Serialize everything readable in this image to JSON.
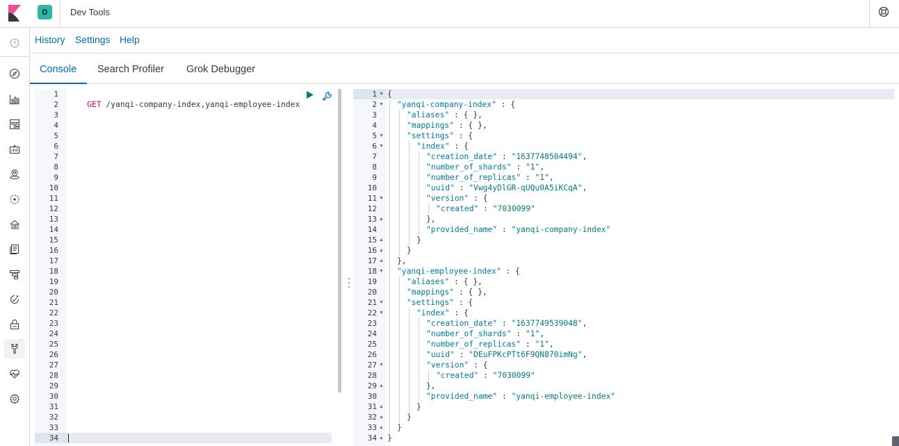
{
  "header": {
    "space_initial": "D",
    "title": "Dev Tools"
  },
  "menu": {
    "history": "History",
    "settings": "Settings",
    "help": "Help"
  },
  "tabs": [
    {
      "label": "Console",
      "active": true
    },
    {
      "label": "Search Profiler",
      "active": false
    },
    {
      "label": "Grok Debugger",
      "active": false
    }
  ],
  "request": {
    "method": "GET",
    "path": " /yanqi-company-index,yanqi-employee-index",
    "line_count": 34,
    "active_line": 34
  },
  "response": {
    "lines": [
      {
        "n": 1,
        "fold": "down",
        "indent": 0,
        "parts": [
          [
            "p",
            "{"
          ]
        ]
      },
      {
        "n": 2,
        "fold": "down",
        "indent": 1,
        "parts": [
          [
            "k",
            "\"yanqi-company-index\""
          ],
          [
            "p",
            " : {"
          ]
        ]
      },
      {
        "n": 3,
        "fold": "",
        "indent": 2,
        "parts": [
          [
            "k",
            "\"aliases\""
          ],
          [
            "p",
            " : { },"
          ]
        ]
      },
      {
        "n": 4,
        "fold": "",
        "indent": 2,
        "parts": [
          [
            "k",
            "\"mappings\""
          ],
          [
            "p",
            " : { },"
          ]
        ]
      },
      {
        "n": 5,
        "fold": "down",
        "indent": 2,
        "parts": [
          [
            "k",
            "\"settings\""
          ],
          [
            "p",
            " : {"
          ]
        ]
      },
      {
        "n": 6,
        "fold": "down",
        "indent": 3,
        "parts": [
          [
            "k",
            "\"index\""
          ],
          [
            "p",
            " : {"
          ]
        ]
      },
      {
        "n": 7,
        "fold": "",
        "indent": 4,
        "parts": [
          [
            "k",
            "\"creation_date\""
          ],
          [
            "p",
            " : "
          ],
          [
            "s",
            "\"1637748504494\""
          ],
          [
            "p",
            ","
          ]
        ]
      },
      {
        "n": 8,
        "fold": "",
        "indent": 4,
        "parts": [
          [
            "k",
            "\"number_of_shards\""
          ],
          [
            "p",
            " : "
          ],
          [
            "s",
            "\"1\""
          ],
          [
            "p",
            ","
          ]
        ]
      },
      {
        "n": 9,
        "fold": "",
        "indent": 4,
        "parts": [
          [
            "k",
            "\"number_of_replicas\""
          ],
          [
            "p",
            " : "
          ],
          [
            "s",
            "\"1\""
          ],
          [
            "p",
            ","
          ]
        ]
      },
      {
        "n": 10,
        "fold": "",
        "indent": 4,
        "parts": [
          [
            "k",
            "\"uuid\""
          ],
          [
            "p",
            " : "
          ],
          [
            "s",
            "\"Vwg4yDlGR-qUQu0A5iKCqA\""
          ],
          [
            "p",
            ","
          ]
        ]
      },
      {
        "n": 11,
        "fold": "down",
        "indent": 4,
        "parts": [
          [
            "k",
            "\"version\""
          ],
          [
            "p",
            " : {"
          ]
        ]
      },
      {
        "n": 12,
        "fold": "",
        "indent": 5,
        "parts": [
          [
            "k",
            "\"created\""
          ],
          [
            "p",
            " : "
          ],
          [
            "s",
            "\"7030099\""
          ]
        ]
      },
      {
        "n": 13,
        "fold": "up",
        "indent": 4,
        "parts": [
          [
            "p",
            "},"
          ]
        ]
      },
      {
        "n": 14,
        "fold": "",
        "indent": 4,
        "parts": [
          [
            "k",
            "\"provided_name\""
          ],
          [
            "p",
            " : "
          ],
          [
            "s",
            "\"yanqi-company-index\""
          ]
        ]
      },
      {
        "n": 15,
        "fold": "up",
        "indent": 3,
        "parts": [
          [
            "p",
            "}"
          ]
        ]
      },
      {
        "n": 16,
        "fold": "up",
        "indent": 2,
        "parts": [
          [
            "p",
            "}"
          ]
        ]
      },
      {
        "n": 17,
        "fold": "up",
        "indent": 1,
        "parts": [
          [
            "p",
            "},"
          ]
        ]
      },
      {
        "n": 18,
        "fold": "down",
        "indent": 1,
        "parts": [
          [
            "k",
            "\"yanqi-employee-index\""
          ],
          [
            "p",
            " : {"
          ]
        ]
      },
      {
        "n": 19,
        "fold": "",
        "indent": 2,
        "parts": [
          [
            "k",
            "\"aliases\""
          ],
          [
            "p",
            " : { },"
          ]
        ]
      },
      {
        "n": 20,
        "fold": "",
        "indent": 2,
        "parts": [
          [
            "k",
            "\"mappings\""
          ],
          [
            "p",
            " : { },"
          ]
        ]
      },
      {
        "n": 21,
        "fold": "down",
        "indent": 2,
        "parts": [
          [
            "k",
            "\"settings\""
          ],
          [
            "p",
            " : {"
          ]
        ]
      },
      {
        "n": 22,
        "fold": "down",
        "indent": 3,
        "parts": [
          [
            "k",
            "\"index\""
          ],
          [
            "p",
            " : {"
          ]
        ]
      },
      {
        "n": 23,
        "fold": "",
        "indent": 4,
        "parts": [
          [
            "k",
            "\"creation_date\""
          ],
          [
            "p",
            " : "
          ],
          [
            "s",
            "\"1637749539048\""
          ],
          [
            "p",
            ","
          ]
        ]
      },
      {
        "n": 24,
        "fold": "",
        "indent": 4,
        "parts": [
          [
            "k",
            "\"number_of_shards\""
          ],
          [
            "p",
            " : "
          ],
          [
            "s",
            "\"1\""
          ],
          [
            "p",
            ","
          ]
        ]
      },
      {
        "n": 25,
        "fold": "",
        "indent": 4,
        "parts": [
          [
            "k",
            "\"number_of_replicas\""
          ],
          [
            "p",
            " : "
          ],
          [
            "s",
            "\"1\""
          ],
          [
            "p",
            ","
          ]
        ]
      },
      {
        "n": 26,
        "fold": "",
        "indent": 4,
        "parts": [
          [
            "k",
            "\"uuid\""
          ],
          [
            "p",
            " : "
          ],
          [
            "s",
            "\"DEuFPKcPTt6F9QN870imNg\""
          ],
          [
            "p",
            ","
          ]
        ]
      },
      {
        "n": 27,
        "fold": "down",
        "indent": 4,
        "parts": [
          [
            "k",
            "\"version\""
          ],
          [
            "p",
            " : {"
          ]
        ]
      },
      {
        "n": 28,
        "fold": "",
        "indent": 5,
        "parts": [
          [
            "k",
            "\"created\""
          ],
          [
            "p",
            " : "
          ],
          [
            "s",
            "\"7030099\""
          ]
        ]
      },
      {
        "n": 29,
        "fold": "up",
        "indent": 4,
        "parts": [
          [
            "p",
            "},"
          ]
        ]
      },
      {
        "n": 30,
        "fold": "",
        "indent": 4,
        "parts": [
          [
            "k",
            "\"provided_name\""
          ],
          [
            "p",
            " : "
          ],
          [
            "s",
            "\"yanqi-employee-index\""
          ]
        ]
      },
      {
        "n": 31,
        "fold": "up",
        "indent": 3,
        "parts": [
          [
            "p",
            "}"
          ]
        ]
      },
      {
        "n": 32,
        "fold": "up",
        "indent": 2,
        "parts": [
          [
            "p",
            "}"
          ]
        ]
      },
      {
        "n": 33,
        "fold": "up",
        "indent": 1,
        "parts": [
          [
            "p",
            "}"
          ]
        ]
      },
      {
        "n": 34,
        "fold": "up",
        "indent": 0,
        "parts": [
          [
            "p",
            "}"
          ]
        ]
      }
    ]
  },
  "sidebar": {
    "items": [
      {
        "icon": "clock-icon"
      },
      {
        "icon": "compass-icon"
      },
      {
        "icon": "visualize-icon"
      },
      {
        "icon": "dashboard-icon"
      },
      {
        "icon": "canvas-icon"
      },
      {
        "icon": "maps-icon"
      },
      {
        "icon": "ml-icon"
      },
      {
        "icon": "infrastructure-icon"
      },
      {
        "icon": "logs-icon"
      },
      {
        "icon": "apm-icon"
      },
      {
        "icon": "uptime-icon"
      },
      {
        "icon": "siem-icon"
      },
      {
        "icon": "devtools-icon",
        "active": true
      },
      {
        "icon": "monitoring-icon"
      },
      {
        "icon": "management-icon"
      }
    ]
  },
  "colors": {
    "accent": "#006bb4",
    "get_method": "#c80a68",
    "json_key": "#0079a5",
    "json_string": "#017d73"
  }
}
